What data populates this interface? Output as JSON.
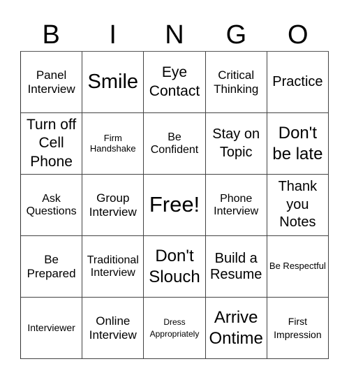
{
  "header": {
    "letters": [
      "B",
      "I",
      "N",
      "G",
      "O"
    ]
  },
  "cells": [
    [
      "Panel Interview",
      "Smile",
      "Eye Contact",
      "Critical Thinking",
      "Practice"
    ],
    [
      "Turn off Cell Phone",
      "Firm Handshake",
      "Be Confident",
      "Stay on Topic",
      "Don't be late"
    ],
    [
      "Ask Questions",
      "Group Interview",
      "Free!",
      "Phone Interview",
      "Thank you Notes"
    ],
    [
      "Be Prepared",
      "Traditional Interview",
      "Don't Slouch",
      "Build a Resume",
      "Be Respectful"
    ],
    [
      "Interviewer",
      "Online Interview",
      "Dress Appropriately",
      "Arrive Ontime",
      "First Impression"
    ]
  ]
}
